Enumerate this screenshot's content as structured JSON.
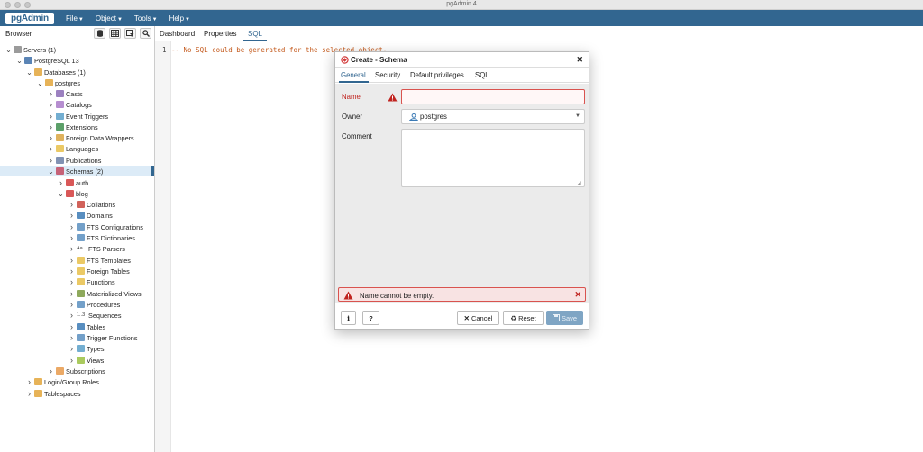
{
  "window": {
    "title": "pgAdmin 4"
  },
  "menubar": {
    "logo": "pgAdmin",
    "items": [
      "File",
      "Object",
      "Tools",
      "Help"
    ]
  },
  "browser": {
    "title": "Browser",
    "tree": [
      {
        "label": "Servers (1)",
        "icon": "servers-icon",
        "color": "#8a8a8a"
      },
      {
        "label": "PostgreSQL 13",
        "icon": "server-icon",
        "color": "#3d6fa8"
      },
      {
        "label": "Databases (1)",
        "icon": "databases-icon",
        "color": "#e3a63b"
      },
      {
        "label": "postgres",
        "icon": "database-icon",
        "color": "#e3a63b"
      },
      {
        "label": "Casts",
        "icon": "casts-icon",
        "color": "#8b6bb5"
      },
      {
        "label": "Catalogs",
        "icon": "catalogs-icon",
        "color": "#a97ac8"
      },
      {
        "label": "Event Triggers",
        "icon": "event-triggers-icon",
        "color": "#5aa0c9"
      },
      {
        "label": "Extensions",
        "icon": "extensions-icon",
        "color": "#3f8f4f"
      },
      {
        "label": "Foreign Data Wrappers",
        "icon": "fdw-icon",
        "color": "#d9a441"
      },
      {
        "label": "Languages",
        "icon": "languages-icon",
        "color": "#e7c04a"
      },
      {
        "label": "Publications",
        "icon": "publications-icon",
        "color": "#6b7fa6"
      },
      {
        "label": "Schemas (2)",
        "icon": "schemas-icon",
        "color": "#c24a62"
      },
      {
        "label": "auth",
        "icon": "schema-icon",
        "color": "#d23b3b"
      },
      {
        "label": "blog",
        "icon": "schema-icon",
        "color": "#d23b3b"
      },
      {
        "label": "Collations",
        "icon": "collations-icon",
        "color": "#c9473d"
      },
      {
        "label": "Domains",
        "icon": "domains-icon",
        "color": "#3b7ab5"
      },
      {
        "label": "FTS Configurations",
        "icon": "fts-config-icon",
        "color": "#5a8fbf"
      },
      {
        "label": "FTS Dictionaries",
        "icon": "fts-dict-icon",
        "color": "#5a8fbf"
      },
      {
        "label": "FTS Parsers",
        "icon": "fts-parsers-icon",
        "glyph": "Aa"
      },
      {
        "label": "FTS Templates",
        "icon": "fts-templates-icon",
        "color": "#e7c04a"
      },
      {
        "label": "Foreign Tables",
        "icon": "foreign-tables-icon",
        "color": "#e7c04a"
      },
      {
        "label": "Functions",
        "icon": "functions-icon",
        "color": "#e7c04a"
      },
      {
        "label": "Materialized Views",
        "icon": "mviews-icon",
        "color": "#7a9a3f"
      },
      {
        "label": "Procedures",
        "icon": "procedures-icon",
        "color": "#5a8fbf"
      },
      {
        "label": "Sequences",
        "icon": "sequences-icon",
        "glyph": "1..3"
      },
      {
        "label": "Tables",
        "icon": "tables-icon",
        "color": "#3b7ab5"
      },
      {
        "label": "Trigger Functions",
        "icon": "trigger-functions-icon",
        "color": "#5a8fbf"
      },
      {
        "label": "Types",
        "icon": "types-icon",
        "color": "#5aa0c9"
      },
      {
        "label": "Views",
        "icon": "views-icon",
        "color": "#9bc142"
      },
      {
        "label": "Subscriptions",
        "icon": "subscriptions-icon",
        "color": "#e89a4b"
      },
      {
        "label": "Login/Group Roles",
        "icon": "roles-icon",
        "color": "#e3a63b"
      },
      {
        "label": "Tablespaces",
        "icon": "tablespaces-icon",
        "color": "#e3a63b"
      }
    ]
  },
  "tabs": [
    "Dashboard",
    "Properties",
    "SQL"
  ],
  "sql": {
    "line": "1",
    "text": "-- No SQL could be generated for the selected object."
  },
  "dialog": {
    "title": "Create - Schema",
    "tabs": [
      "General",
      "Security",
      "Default privileges",
      "SQL"
    ],
    "fields": {
      "name_label": "Name",
      "name_value": "",
      "owner_label": "Owner",
      "owner_value": "postgres",
      "comment_label": "Comment",
      "comment_value": ""
    },
    "error": "Name cannot be empty.",
    "buttons": {
      "info": "i",
      "help": "?",
      "cancel": "Cancel",
      "reset": "Reset",
      "save": "Save"
    }
  },
  "colors": {
    "brand": "#326690",
    "error": "#d9534f"
  }
}
